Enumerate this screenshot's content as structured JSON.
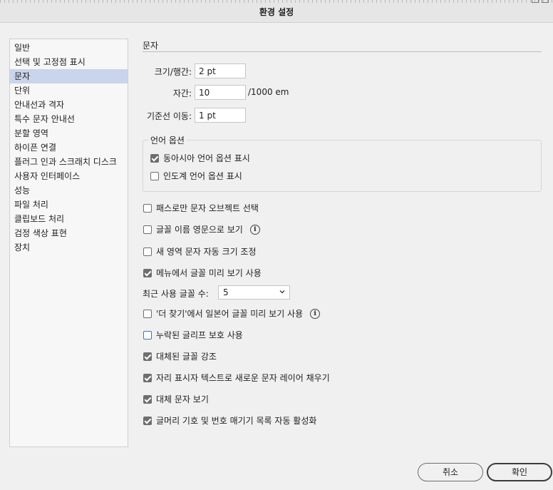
{
  "window": {
    "title": "환경 설정"
  },
  "sidebar": {
    "items": [
      {
        "label": "일반",
        "active": false
      },
      {
        "label": "선택 및 고정점 표시",
        "active": false
      },
      {
        "label": "문자",
        "active": true
      },
      {
        "label": "단위",
        "active": false
      },
      {
        "label": "안내선과 격자",
        "active": false
      },
      {
        "label": "특수 문자 안내선",
        "active": false
      },
      {
        "label": "분할 영역",
        "active": false
      },
      {
        "label": "하이픈 연결",
        "active": false
      },
      {
        "label": "플러그 인과 스크래치 디스크",
        "active": false
      },
      {
        "label": "사용자 인터페이스",
        "active": false
      },
      {
        "label": "성능",
        "active": false
      },
      {
        "label": "파일 처리",
        "active": false
      },
      {
        "label": "클립보드 처리",
        "active": false
      },
      {
        "label": "검정 색상 표현",
        "active": false
      },
      {
        "label": "장치",
        "active": false
      }
    ]
  },
  "panel": {
    "title": "문자",
    "size_leading": {
      "label": "크기/행간:",
      "value": "2 pt"
    },
    "tracking": {
      "label": "자간:",
      "value": "10",
      "unit": "/1000 em"
    },
    "baseline_shift": {
      "label": "기준선 이동:",
      "value": "1 pt"
    },
    "language_options": {
      "title": "언어 옵션",
      "east_asian": {
        "label": "동아시아 언어 옵션 표시",
        "checked": true
      },
      "indic": {
        "label": "인도계 언어 옵션 표시",
        "checked": false
      }
    },
    "options": {
      "path_only": {
        "label": "패스로만 문자 오브젝트 선택",
        "checked": false
      },
      "font_names_english": {
        "label": "글꼴 이름 영문으로 보기",
        "checked": false
      },
      "auto_size": {
        "label": "새 영역 문자 자동 크기 조정",
        "checked": false
      },
      "menu_preview": {
        "label": "메뉴에서 글꼴 미리 보기 사용",
        "checked": true
      }
    },
    "recent_fonts": {
      "label": "최근 사용 글꼴 수:",
      "value": "5"
    },
    "options2": {
      "japanese_preview": {
        "label": "'더 찾기'에서 일본어 글꼴 미리 보기 사용",
        "checked": false
      },
      "missing_glyph": {
        "label": "누락된 글리프 보호 사용",
        "checked": false
      },
      "highlight_substituted": {
        "label": "대체된 글꼴 강조",
        "checked": true
      },
      "fill_placeholder": {
        "label": "자리 표시자 텍스트로 새로운 문자 레이어 채우기",
        "checked": true
      },
      "show_alternates": {
        "label": "대체 문자 보기",
        "checked": true
      },
      "auto_lists": {
        "label": "글머리 기호 및 번호 매기기 목록 자동 활성화",
        "checked": true
      }
    }
  },
  "buttons": {
    "cancel": "취소",
    "ok": "확인"
  },
  "icons": {
    "info": "info-icon",
    "chevron": "chevron-down-icon",
    "check": "checkbox-check-icon"
  },
  "colors": {
    "selection": "#c9d5ec",
    "focus": "#3a73c8",
    "checkbox": "#6e6e6e"
  }
}
